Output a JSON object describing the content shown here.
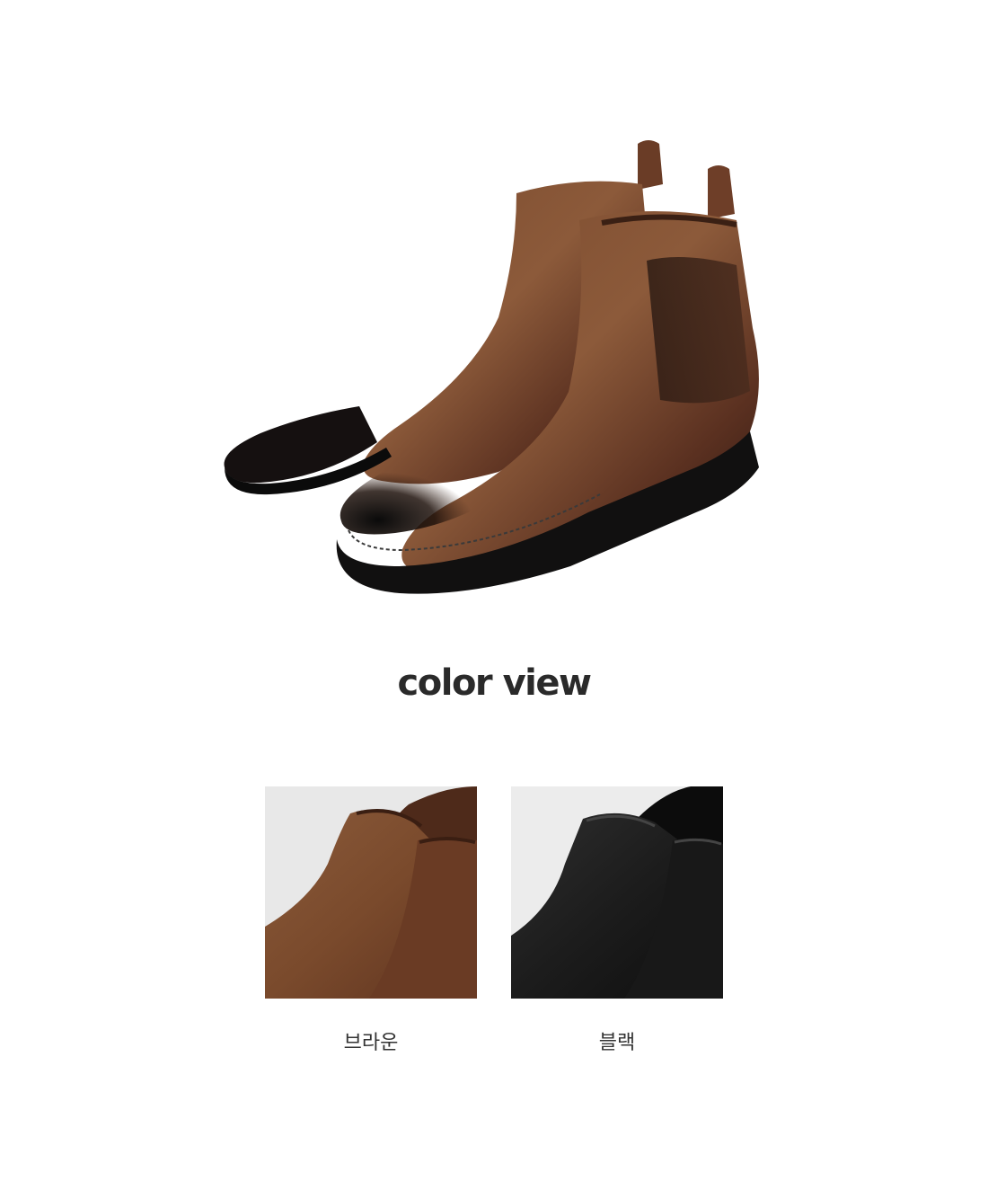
{
  "hero": {
    "image_name": "chelsea-boots-brown-pair"
  },
  "section": {
    "title": "color view"
  },
  "colors": [
    {
      "label": "브라운",
      "swatch_color": "#6b3a22"
    },
    {
      "label": "블랙",
      "swatch_color": "#1c1c1c"
    }
  ],
  "palette": {
    "brown_leather": "#6b3a22",
    "brown_highlight": "#9a6a4a",
    "black_leather": "#161616",
    "title_color": "#2a2a2a"
  }
}
